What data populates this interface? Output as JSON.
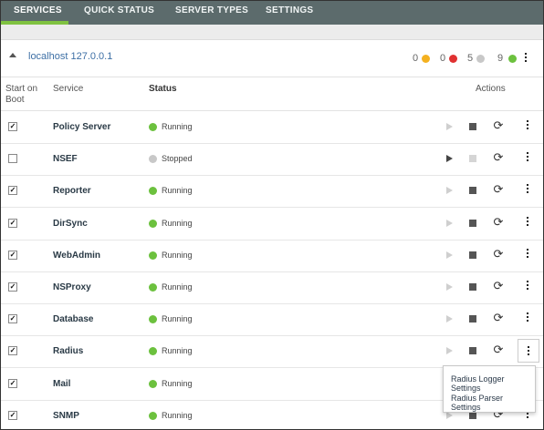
{
  "tabs": [
    {
      "label": "SERVICES"
    },
    {
      "label": "QUICK STATUS"
    },
    {
      "label": "SERVER TYPES"
    },
    {
      "label": "SETTINGS"
    }
  ],
  "server": {
    "name": "localhost 127.0.0.1",
    "counts": [
      {
        "value": "0",
        "color": "#f4b120"
      },
      {
        "value": "0",
        "color": "#e03131"
      },
      {
        "value": "5",
        "color": "#c8c8c8"
      },
      {
        "value": "9",
        "color": "#6cc13e"
      }
    ]
  },
  "table": {
    "headers": {
      "boot": "Start on Boot",
      "service": "Service",
      "status": "Status",
      "actions": "Actions"
    },
    "rows": [
      {
        "checked": "✓",
        "service": "Policy Server",
        "status": "Running"
      },
      {
        "checked": "",
        "service": "NSEF",
        "status": "Stopped"
      },
      {
        "checked": "✓",
        "service": "Reporter",
        "status": "Running"
      },
      {
        "checked": "✓",
        "service": "DirSync",
        "status": "Running"
      },
      {
        "checked": "✓",
        "service": "WebAdmin",
        "status": "Running"
      },
      {
        "checked": "✓",
        "service": "NSProxy",
        "status": "Running"
      },
      {
        "checked": "✓",
        "service": "Database",
        "status": "Running"
      },
      {
        "checked": "✓",
        "service": "Radius",
        "status": "Running"
      },
      {
        "checked": "✓",
        "service": "Mail",
        "status": "Running"
      },
      {
        "checked": "✓",
        "service": "SNMP",
        "status": "Running"
      }
    ]
  },
  "status_colors": {
    "running": "#6cc13e",
    "stopped": "#c8c8c8"
  },
  "popup": {
    "items": [
      {
        "label": "Radius Logger Settings"
      },
      {
        "label": "Radius Parser Settings"
      }
    ]
  },
  "icons": {
    "collapse": "triangle-up-icon",
    "start": "play-icon",
    "stop": "stop-icon",
    "restart": "restart-icon",
    "menu": "kebab-menu-icon"
  }
}
